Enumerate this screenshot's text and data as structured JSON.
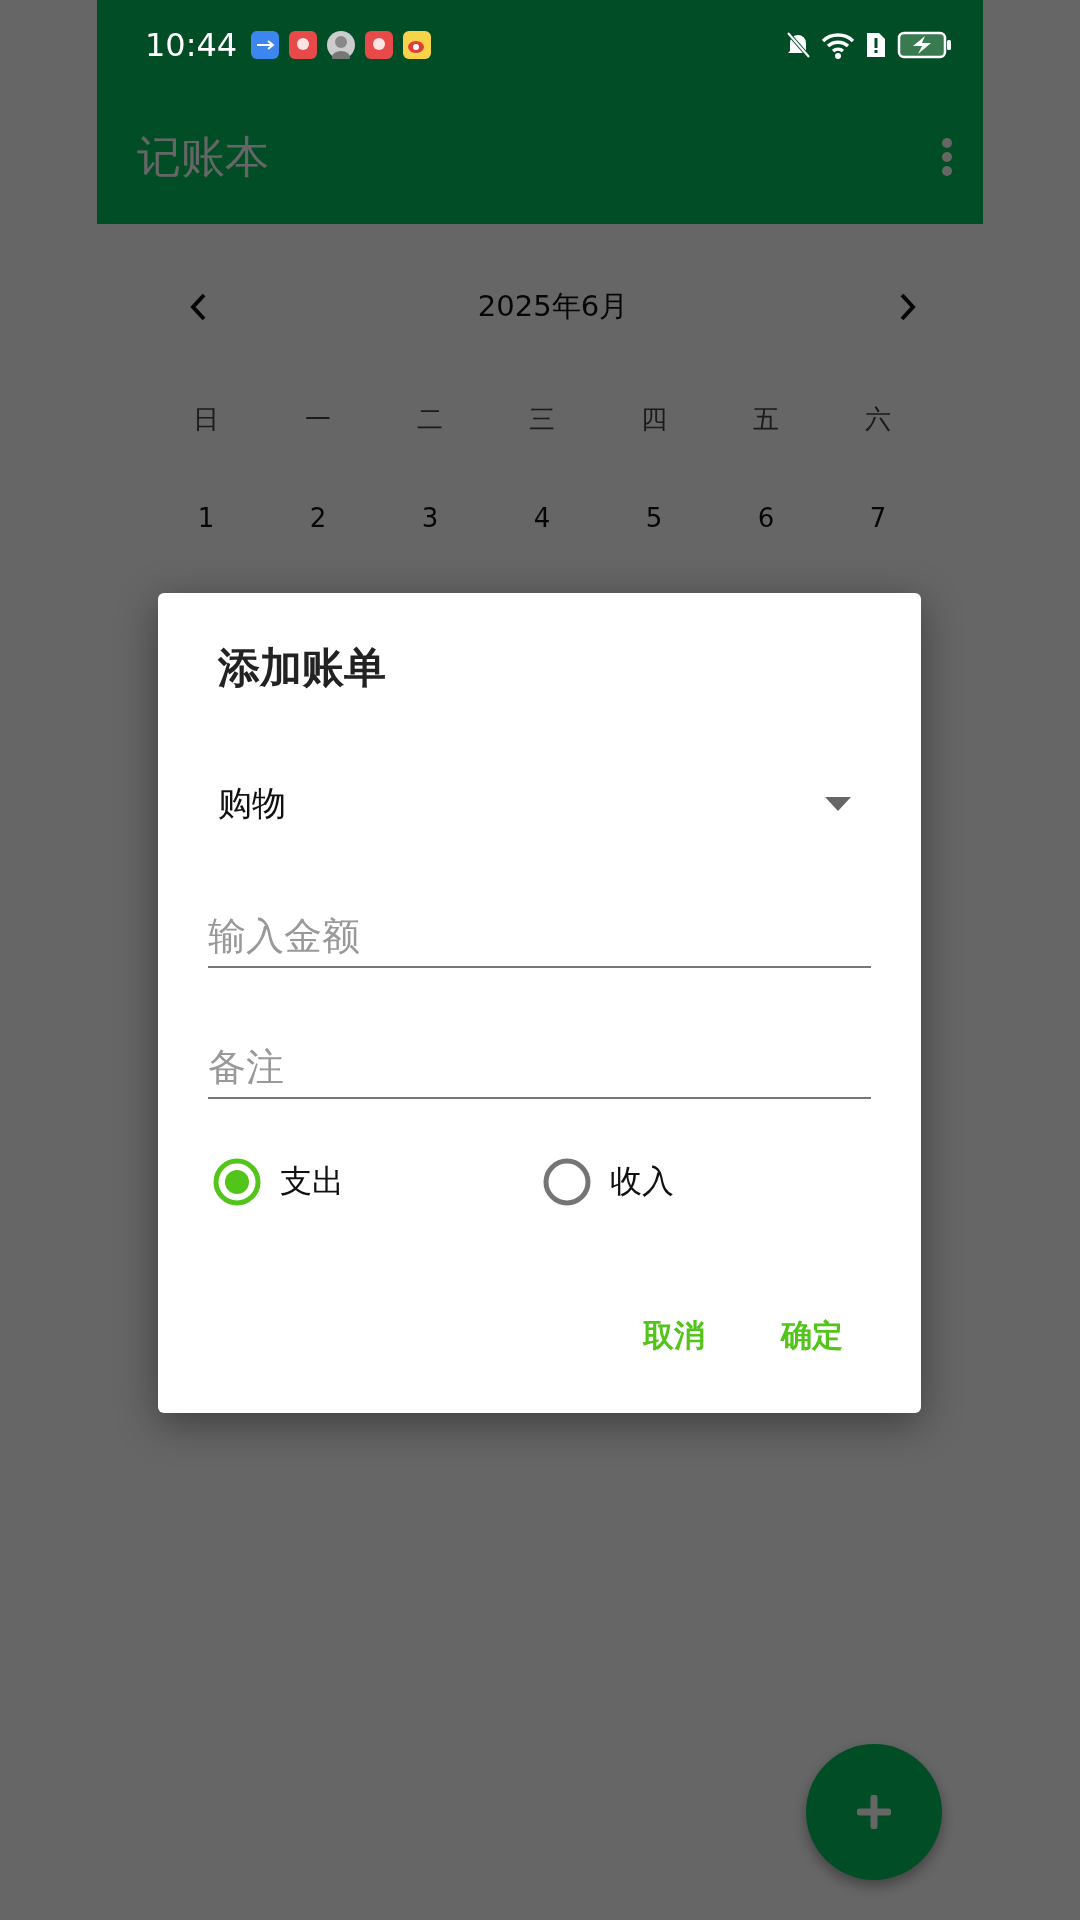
{
  "status_bar": {
    "time": "10:44"
  },
  "app_bar": {
    "title": "记账本"
  },
  "calendar": {
    "month": "2025年6月",
    "weekdays": [
      "日",
      "一",
      "二",
      "三",
      "四",
      "五",
      "六"
    ],
    "days": [
      "1",
      "2",
      "3",
      "4",
      "5",
      "6",
      "7"
    ]
  },
  "dialog": {
    "title": "添加账单",
    "category": "购物",
    "amount": {
      "placeholder": "输入金额"
    },
    "note": {
      "placeholder": "备注"
    },
    "types": [
      {
        "label": "支出",
        "selected": true
      },
      {
        "label": "收入",
        "selected": false
      }
    ],
    "buttons": [
      "取消",
      "确定"
    ]
  }
}
